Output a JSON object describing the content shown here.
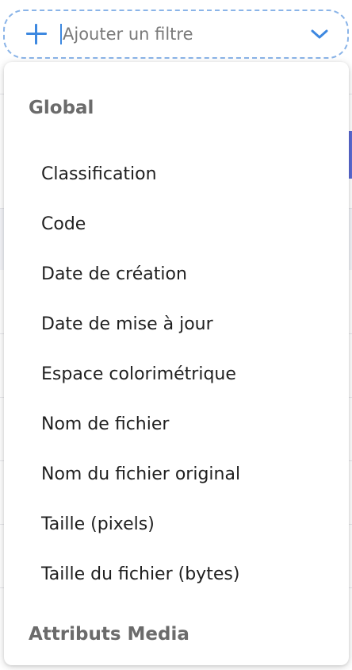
{
  "filter": {
    "placeholder": "Ajouter un filtre"
  },
  "dropdown": {
    "groups": [
      {
        "label": "Global",
        "options": [
          "Classification",
          "Code",
          "Date de création",
          "Date de mise à jour",
          "Espace colorimétrique",
          "Nom de fichier",
          "Nom du fichier original",
          "Taille (pixels)",
          "Taille du fichier (bytes)"
        ]
      },
      {
        "label": "Attributs Media",
        "options": []
      }
    ]
  },
  "colors": {
    "accent": "#3d88e0",
    "dashed_border": "#8ab4e8",
    "group_header": "#6b6b6b",
    "option_text": "#1f1f1f"
  },
  "icons": {
    "add": "plus-icon",
    "expand": "chevron-down-icon"
  }
}
